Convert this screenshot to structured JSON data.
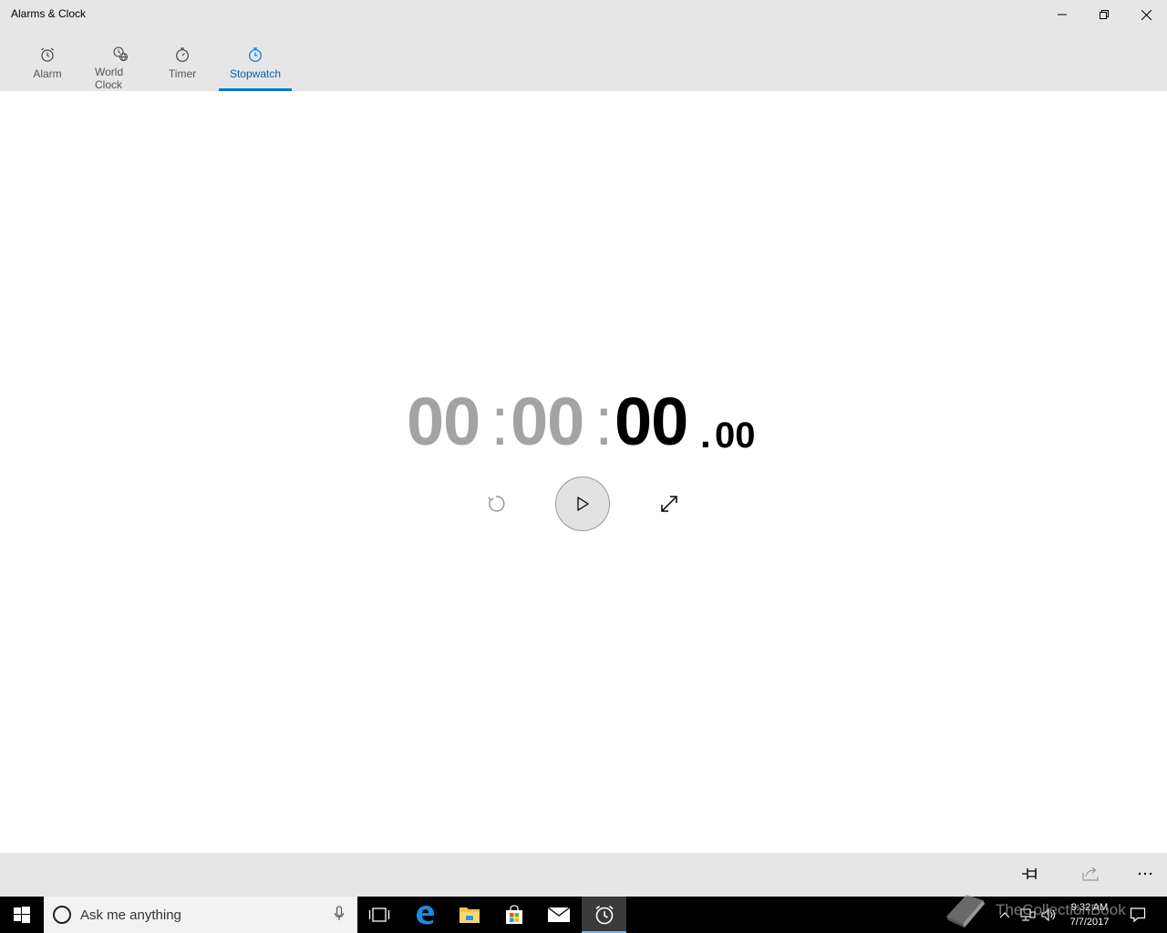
{
  "window": {
    "title": "Alarms & Clock"
  },
  "tabs": [
    {
      "label": "Alarm",
      "icon": "alarm-icon"
    },
    {
      "label": "World Clock",
      "icon": "world-clock-icon"
    },
    {
      "label": "Timer",
      "icon": "timer-icon"
    },
    {
      "label": "Stopwatch",
      "icon": "stopwatch-icon",
      "active": true
    }
  ],
  "stopwatch": {
    "hours": "00",
    "minutes": "00",
    "seconds": "00",
    "centiseconds": "00",
    "separator": ":",
    "decimal": "."
  },
  "taskbar": {
    "search_placeholder": "Ask me anything",
    "time": "9:32 AM",
    "date": "7/7/2017"
  },
  "watermark": {
    "text": "TheCollectionBook"
  },
  "colors": {
    "accent": "#0078d7",
    "accent_text": "#0063b1",
    "header_bg": "#e6e6e6",
    "digits_dim": "#a3a3a3",
    "digits_active": "#000000"
  }
}
